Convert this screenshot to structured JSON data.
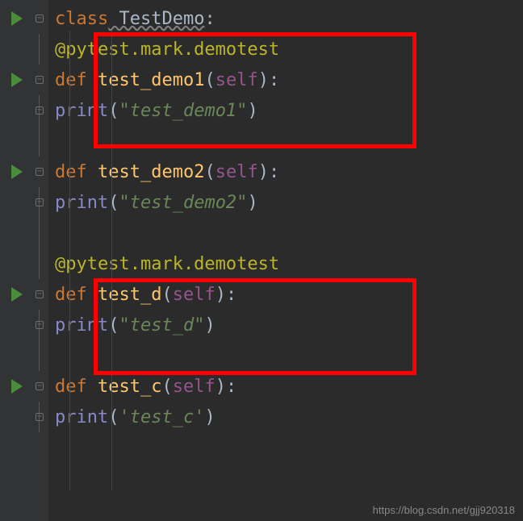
{
  "code": {
    "class_kw": "class",
    "class_name": " TestDemo",
    "colon": ":",
    "decorator": "@pytest.mark.demotest",
    "def_kw": "def",
    "self_kw": "self",
    "print_fn": "print",
    "lparen": "(",
    "rparen": ")",
    "methods": [
      {
        "name": " test_demo1",
        "str": "\"test_demo1\""
      },
      {
        "name": " test_demo2",
        "str": "\"test_demo2\""
      },
      {
        "name": " test_d",
        "str": "\"test_d\""
      },
      {
        "name": " test_c",
        "str": "'test_c'"
      }
    ]
  },
  "watermark": "https://blog.csdn.net/gjj920318"
}
